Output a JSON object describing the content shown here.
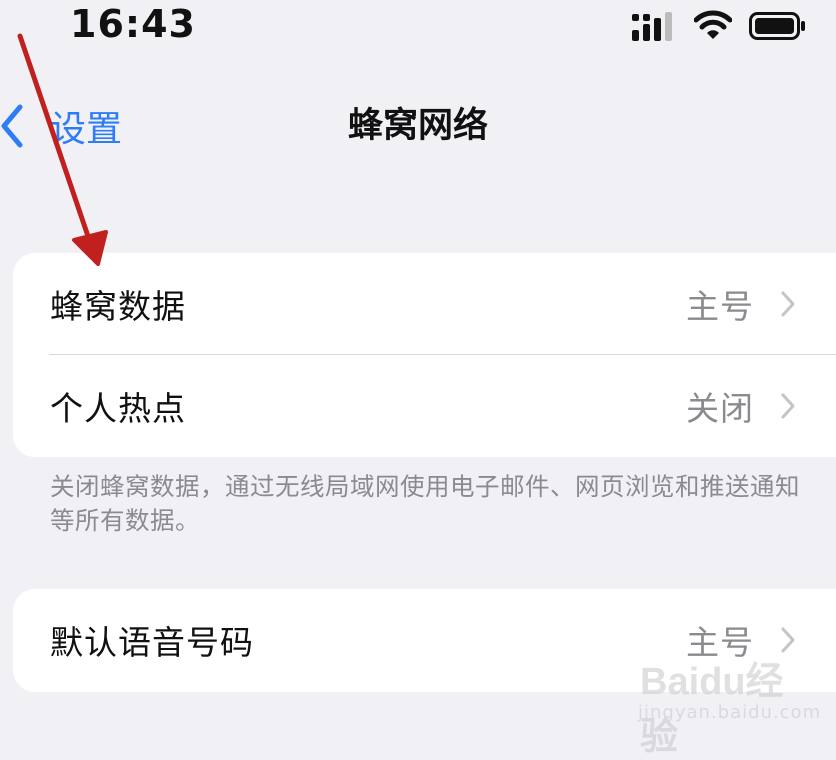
{
  "status_bar": {
    "time": "16:43"
  },
  "nav": {
    "back_label": "设置",
    "title": "蜂窝网络"
  },
  "group1": {
    "rows": [
      {
        "label": "蜂窝数据",
        "value": "主号"
      },
      {
        "label": "个人热点",
        "value": "关闭"
      }
    ],
    "footnote": "关闭蜂窝数据，通过无线局域网使用电子邮件、网页浏览和推送通知等所有数据。"
  },
  "group2": {
    "rows": [
      {
        "label": "默认语音号码",
        "value": "主号"
      }
    ]
  },
  "colors": {
    "accent": "#2f7df6",
    "annotation_arrow": "#c0211f"
  },
  "watermark": {
    "logo": "Baidu经验",
    "url": "jingyan.baidu.com"
  }
}
